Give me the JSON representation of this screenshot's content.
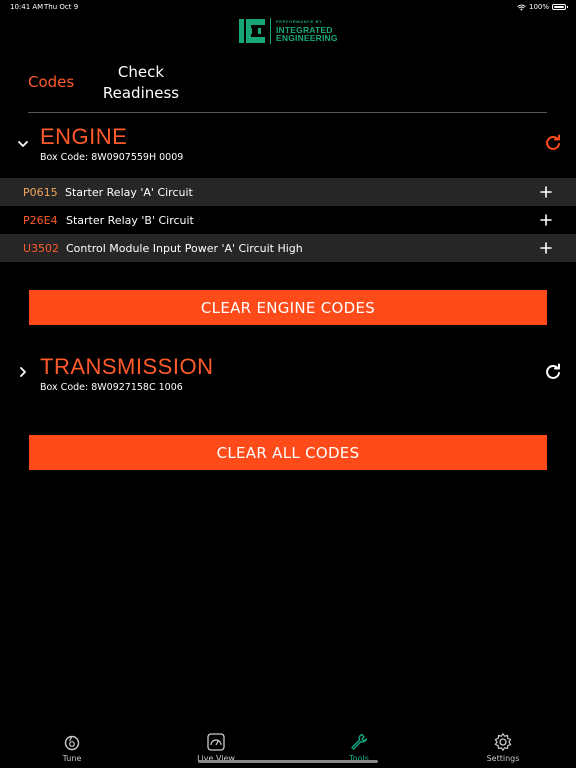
{
  "status_bar": {
    "time": "10:41 AM",
    "date": "Thu Oct 9",
    "battery_percent": "100%",
    "battery_level": 1.0,
    "icons": [
      "wifi-icon",
      "battery-icon"
    ]
  },
  "logo": {
    "small_text": "PERFORMANCE BY",
    "line1": "INTEGRATED",
    "line2": "ENGINEERING",
    "color": "#18a878"
  },
  "tabs": {
    "codes_label": "Codes",
    "readiness_line1": "Check",
    "readiness_line2": "Readiness",
    "active": "Codes"
  },
  "modules": {
    "engine": {
      "name": "ENGINE",
      "box_code": "Box Code: 8W0907559H 0009",
      "expanded": true,
      "codes": [
        {
          "id": "P0615",
          "description": "Starter Relay 'A' Circuit",
          "color": "#f0a85a"
        },
        {
          "id": "P26E4",
          "description": "Starter Relay 'B' Circuit",
          "color": "#ff5a2a"
        },
        {
          "id": "U3502",
          "description": "Control Module Input Power 'A' Circuit High",
          "color": "#ff5a2a"
        }
      ],
      "clear_label": "CLEAR ENGINE CODES"
    },
    "transmission": {
      "name": "TRANSMISSION",
      "box_code": "Box Code: 8W0927158C 1006",
      "expanded": false
    }
  },
  "clear_all_label": "CLEAR ALL CODES",
  "bottom_nav": {
    "items": [
      {
        "label": "Tune",
        "icon": "tune-icon"
      },
      {
        "label": "Live View",
        "icon": "gauge-icon"
      },
      {
        "label": "Tools",
        "icon": "wrench-icon"
      },
      {
        "label": "Settings",
        "icon": "gear-icon"
      }
    ],
    "active": "Tools"
  },
  "colors": {
    "accent": "#ff4a1a",
    "accent_text": "#ff5a2a",
    "nav_active": "#16b08a",
    "row_dark": "#262626"
  }
}
